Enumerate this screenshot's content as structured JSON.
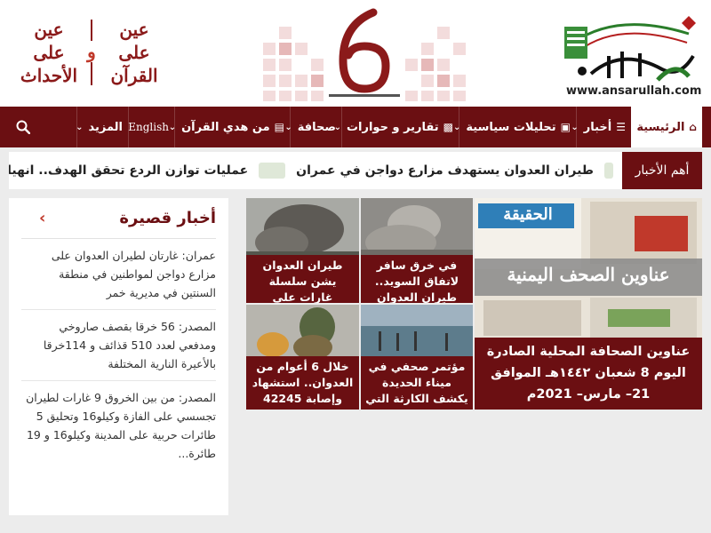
{
  "header": {
    "site_url": "www.ansarullah.com",
    "slogan": {
      "right_lines": [
        "عين",
        "على",
        "القرآن"
      ],
      "left_lines": [
        "عين",
        "على",
        "الأحداث"
      ],
      "conjunction": "و"
    },
    "center_logo_number": "6"
  },
  "nav": {
    "items": [
      {
        "label": "الرئيسية",
        "icon": "home-icon",
        "active": true
      },
      {
        "label": "أخبار",
        "icon": "list-icon",
        "dropdown": true
      },
      {
        "label": "تحليلات سياسية",
        "icon": "map-icon",
        "dropdown": true
      },
      {
        "label": "تقارير و حوارات",
        "icon": "card-icon",
        "dropdown": true
      },
      {
        "label": "صحافة",
        "dropdown": true
      },
      {
        "label": "من هدي القرآن",
        "icon": "book-icon",
        "dropdown": true
      },
      {
        "label": "English"
      },
      {
        "label": "المزيد",
        "dropdown": true
      }
    ],
    "search_icon": "search-icon"
  },
  "ticker": {
    "label": "أهم الأخبار",
    "items": [
      "طيران العدوان يستهدف مزارع دواجن في عمران",
      "عمليات توازن الردع تحقق الهدف.. انهيار ك"
    ]
  },
  "sidebar": {
    "title": "أخبار قصيرة",
    "items": [
      "عمران: غارتان لطيران العدوان على مزارع دواجن لمواطنين في منطقة السنتين في مديرية خمر",
      "المصدر: 56 خرقا بقصف صاروخي ومدفعي لعدد 510 قذائف و 114خرقا بالأعيرة النارية المختلفة",
      "المصدر: من بين الخروق 9 غارات لطيران تجسسي على الفازة وكيلو16 وتحليق 5 طائرات حربية على المدينة وكيلو16 و 19 طائرة..."
    ]
  },
  "tiles": [
    {
      "caption": "في خرق سافر لاتفاق السويد.. طيران العدوان"
    },
    {
      "caption": "طيران العدوان يشن سلسلة غارات على العاصمة"
    },
    {
      "caption": "مؤتمر صحفي في ميناء الحديدة يكشف الكارثة التي"
    },
    {
      "caption": "خلال 6 أعوام من العدوان.. استشهاد وإصابة 42245"
    }
  ],
  "featured": {
    "caption": "عناوين الصحافة المحلية الصادرة اليوم 8 شعبان ١٤٤٢هـ الموافق 21– مارس– 2021م",
    "image_text": [
      "الحقيقة",
      "عناوين الصحف اليمنية"
    ]
  },
  "colors": {
    "brand": "#6b0f12",
    "accent": "#c0392b",
    "background": "#ececec"
  }
}
